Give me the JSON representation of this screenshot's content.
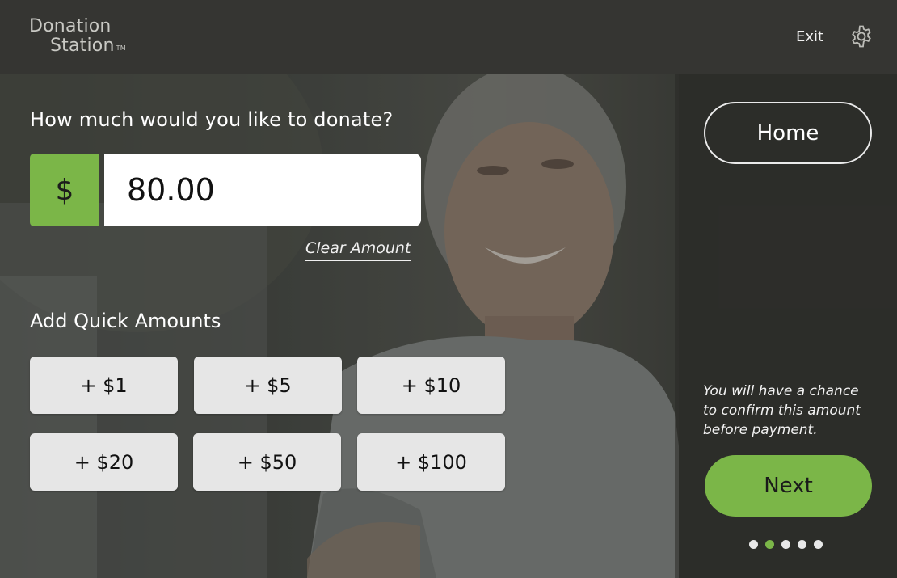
{
  "header": {
    "logo_line1": "Donation",
    "logo_line2": "Station",
    "logo_tm": "TM",
    "exit_label": "Exit",
    "settings_icon": "gear-icon"
  },
  "donation": {
    "question": "How much would you like to donate?",
    "currency_symbol": "$",
    "amount_value": "80.00",
    "clear_label": "Clear Amount"
  },
  "quick_amounts": {
    "title": "Add Quick Amounts",
    "buttons": [
      "+ $1",
      "+ $5",
      "+ $10",
      "+ $20",
      "+ $50",
      "+ $100"
    ]
  },
  "sidebar": {
    "home_label": "Home",
    "confirm_note": "You will have a chance to confirm this amount before payment.",
    "next_label": "Next",
    "pager": {
      "total": 5,
      "active": 2
    }
  },
  "colors": {
    "accent_green": "#7bb648",
    "header_bg": "#353532",
    "button_bg": "#e6e6e6"
  }
}
